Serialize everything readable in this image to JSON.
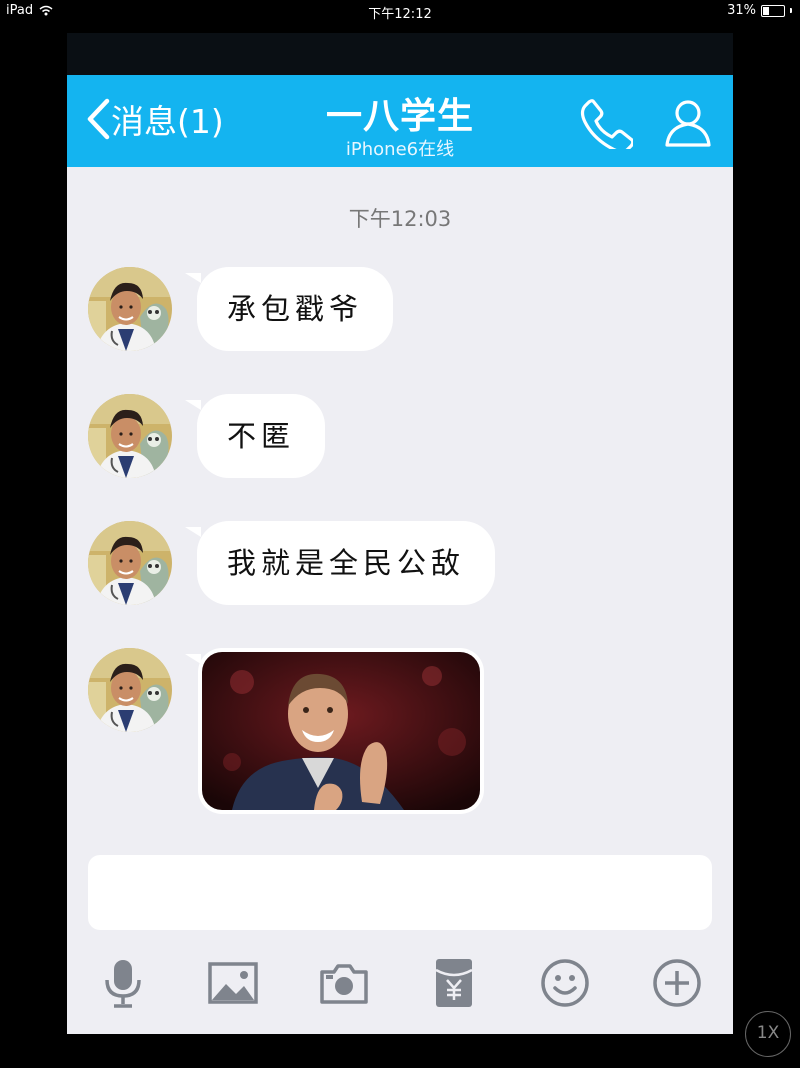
{
  "status_bar": {
    "device": "iPad",
    "time": "下午12:12",
    "battery": "31%",
    "battery_level": 0.31
  },
  "nav": {
    "back_label": "消息(1)",
    "title": "一八学生",
    "subtitle": "iPhone6在线"
  },
  "timestamp": "下午12:03",
  "messages": [
    {
      "type": "text",
      "text": "承包戳爷"
    },
    {
      "type": "text",
      "text": "不匿"
    },
    {
      "type": "text",
      "text": "我就是全民公敌"
    },
    {
      "type": "image"
    }
  ],
  "toolbar": {
    "icons": [
      "microphone-icon",
      "image-icon",
      "camera-icon",
      "red-packet-icon",
      "emoji-icon",
      "plus-icon"
    ]
  },
  "zoom_label": "1X",
  "colors": {
    "nav_blue": "#14b4f0",
    "background": "#eeeef3",
    "icon_gray": "#7f848d"
  }
}
